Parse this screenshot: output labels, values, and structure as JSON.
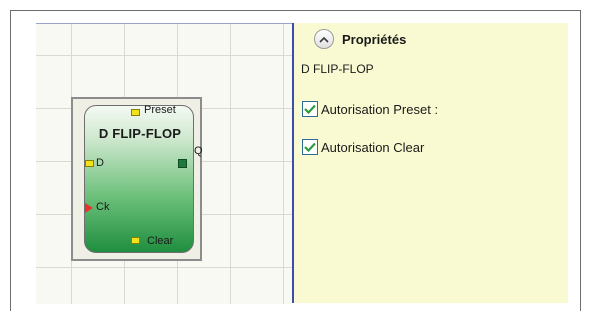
{
  "block": {
    "title": "D FLIP-FLOP",
    "pins": {
      "preset": "Preset",
      "d": "D",
      "ck": "Ck",
      "clear": "Clear",
      "q": "Q"
    }
  },
  "properties": {
    "title": "Propriétés",
    "subtitle": "D FLIP-FLOP",
    "options": [
      {
        "label": "Autorisation Preset :",
        "checked": true
      },
      {
        "label": "Autorisation Clear",
        "checked": true
      }
    ]
  },
  "icons": {
    "collapse": "chevron-up-icon",
    "checkbox": "checkmark-icon"
  },
  "colors": {
    "block_gradient_top": "#f4faf4",
    "block_gradient_bottom": "#1f8e3f",
    "panel_background": "#fafad2",
    "divider": "#3c4fa8",
    "pin_yellow": "#f2e21b",
    "pin_red": "#e8332a",
    "check_green": "#2e9b3e"
  }
}
